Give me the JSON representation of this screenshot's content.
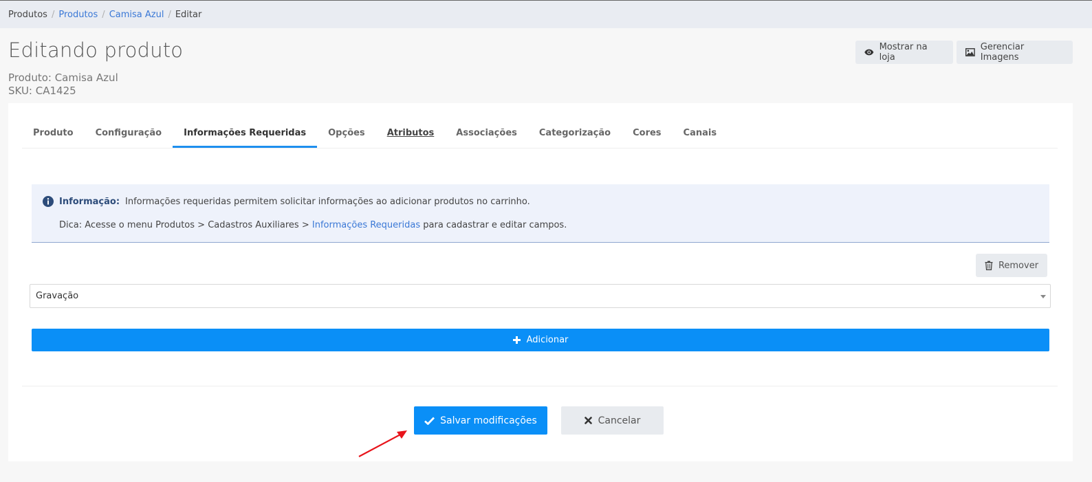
{
  "breadcrumb": {
    "items": [
      "Produtos",
      "Produtos",
      "Camisa Azul",
      "Editar"
    ],
    "separator": "/"
  },
  "page": {
    "title": "Editando produto",
    "product_line": "Produto: Camisa Azul",
    "sku_line": "SKU: CA1425"
  },
  "header_actions": {
    "show_store": "Mostrar na loja",
    "manage_images": "Gerenciar Imagens"
  },
  "tabs": [
    {
      "label": "Produto"
    },
    {
      "label": "Configuração"
    },
    {
      "label": "Informações Requeridas",
      "active": true
    },
    {
      "label": "Opções"
    },
    {
      "label": "Atributos"
    },
    {
      "label": "Associações"
    },
    {
      "label": "Categorização"
    },
    {
      "label": "Cores"
    },
    {
      "label": "Canais"
    }
  ],
  "info": {
    "label": "Informação:",
    "text": "Informações requeridas permitem solicitar informações ao adicionar produtos no carrinho.",
    "tip_prefix": "Dica: Acesse o menu Produtos > Cadastros Auxiliares >",
    "tip_link": "Informações Requeridas",
    "tip_suffix": "para cadastrar e editar campos."
  },
  "required_item": {
    "remove_label": "Remover",
    "selected_value": "Gravação"
  },
  "add_label": "Adicionar",
  "footer": {
    "save_label": "Salvar modificações",
    "cancel_label": "Cancelar"
  },
  "colors": {
    "primary": "#0a8ff7",
    "link": "#3a78d6",
    "info_bg": "#eef2fb",
    "annotation_arrow": "#e8141b"
  }
}
